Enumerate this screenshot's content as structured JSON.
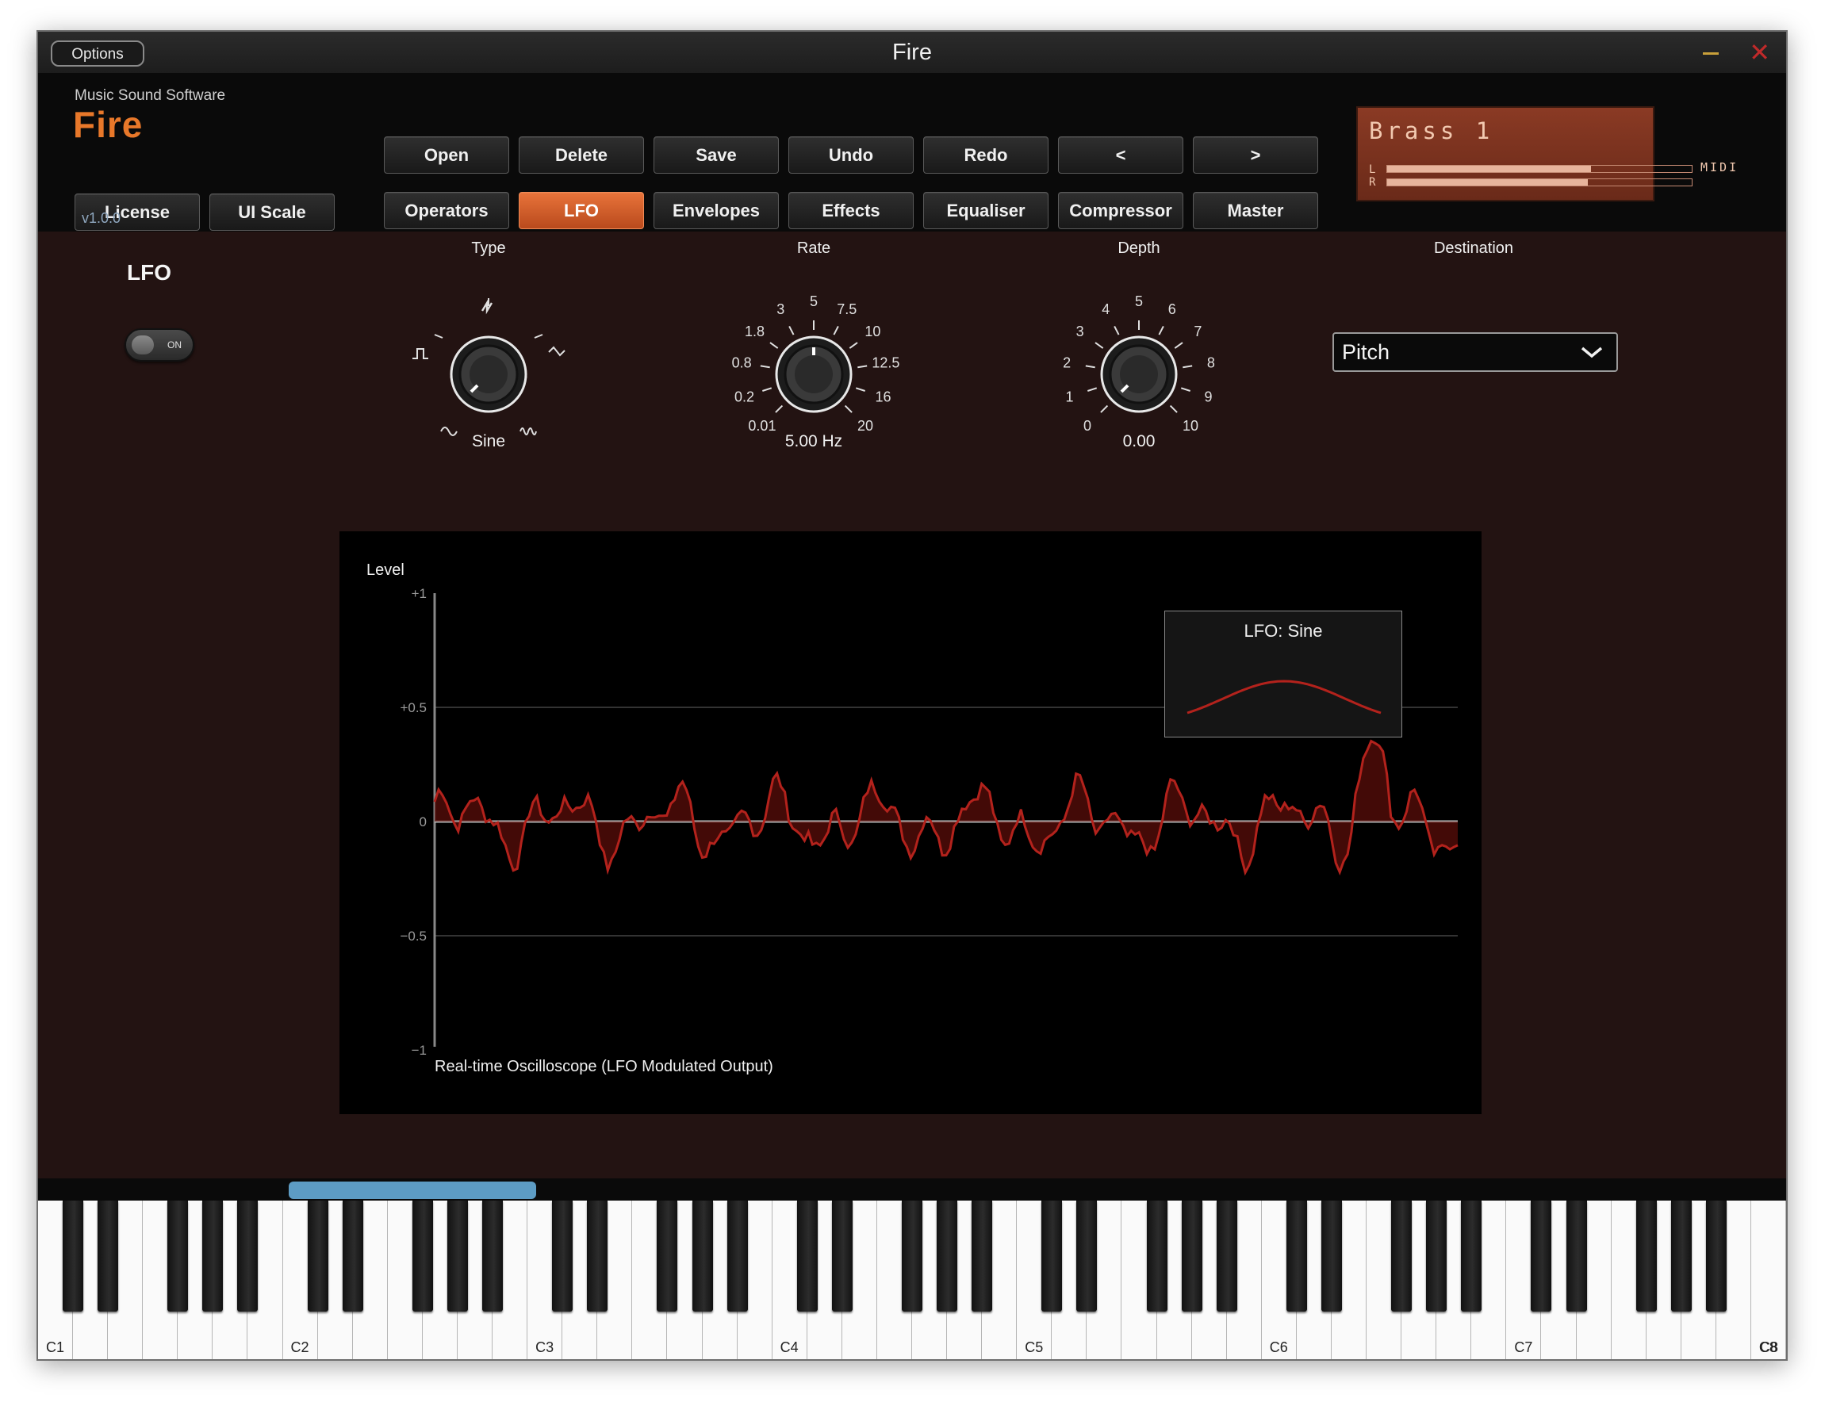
{
  "window": {
    "title": "Fire",
    "options_label": "Options",
    "close_glyph": "✕"
  },
  "brand": {
    "company": "Music Sound Software",
    "product": "Fire",
    "version": "v1.0.0"
  },
  "left_buttons": {
    "license": "License",
    "ui_scale": "UI Scale"
  },
  "toolbar": {
    "open": "Open",
    "delete": "Delete",
    "save": "Save",
    "undo": "Undo",
    "redo": "Redo",
    "prev": "<",
    "next": ">"
  },
  "tabs": {
    "operators": "Operators",
    "lfo": "LFO",
    "envelopes": "Envelopes",
    "effects": "Effects",
    "equaliser": "Equaliser",
    "compressor": "Compressor",
    "master": "Master",
    "active": "LFO"
  },
  "preset": {
    "name": "Brass 1",
    "left_label": "L",
    "right_label": "R",
    "midi_label": "MIDI",
    "level_left": 0.67,
    "level_right": 0.66
  },
  "lfo_panel": {
    "title": "LFO",
    "toggle_label": "ON",
    "toggle_on": true,
    "type": {
      "label": "Type",
      "value": "Sine"
    },
    "rate": {
      "label": "Rate",
      "value": "5.00 Hz",
      "scale": [
        "0.01",
        "0.2",
        "0.8",
        "1.8",
        "3",
        "5",
        "7.5",
        "10",
        "12.5",
        "16",
        "20"
      ]
    },
    "depth": {
      "label": "Depth",
      "value": "0.00",
      "scale": [
        "0",
        "1",
        "2",
        "3",
        "4",
        "5",
        "6",
        "7",
        "8",
        "9",
        "10"
      ]
    },
    "destination": {
      "label": "Destination",
      "value": "Pitch"
    }
  },
  "scope": {
    "ylabel": "Level",
    "caption": "Real-time Oscilloscope (LFO Modulated Output)",
    "ticks": [
      "+1",
      "+0.5",
      "0",
      "−0.5",
      "−1"
    ],
    "inset_title": "LFO: Sine",
    "wave_color": "#b3221c"
  },
  "keyboard": {
    "labels": [
      "C1",
      "C2",
      "C3",
      "C4",
      "C5",
      "C6",
      "C7",
      "C8"
    ]
  },
  "colors": {
    "accent": "#e8733a",
    "panel_bg": "#231312",
    "brand": "#e8782a"
  }
}
